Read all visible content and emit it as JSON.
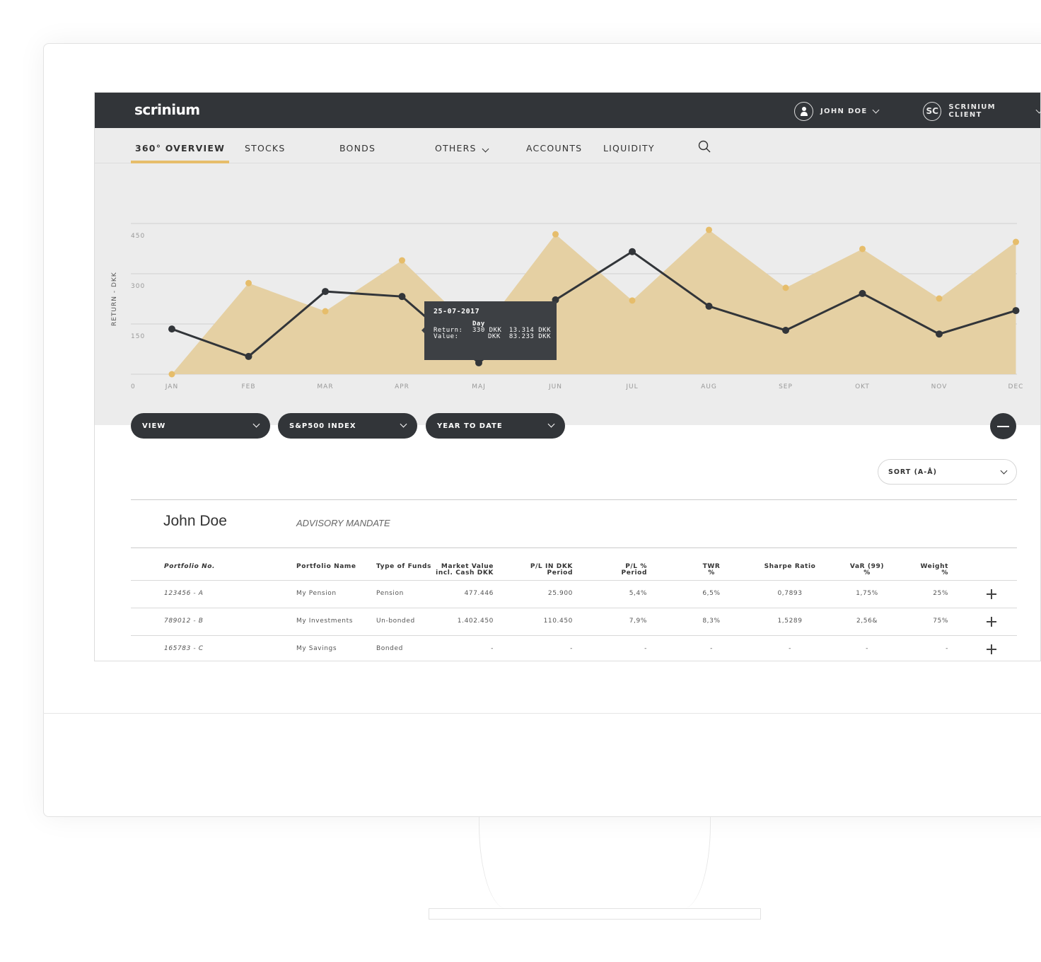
{
  "app": {
    "logo": "scrinium",
    "user": "JOHN DOE",
    "client_initials": "SC",
    "client": "SCRINIUM CLIENT"
  },
  "nav": {
    "tabs": [
      {
        "label": "360° OVERVIEW",
        "active": true
      },
      {
        "label": "STOCKS"
      },
      {
        "label": "BONDS"
      },
      {
        "label": "OTHERS",
        "dropdown": true
      },
      {
        "label": "ACCOUNTS"
      },
      {
        "label": "LIQUIDITY"
      }
    ],
    "search_icon": "search-icon"
  },
  "colors": {
    "accent": "#e6bd6b",
    "area": "#e5d0a3",
    "line": "#323539",
    "dark": "#323539"
  },
  "chart_data": {
    "type": "area+line",
    "ylabel": "RETURN - DKK",
    "ylim": [
      0,
      450
    ],
    "yticks": [
      "0",
      "150",
      "300",
      "450"
    ],
    "categories": [
      "JAN",
      "FEB",
      "MAR",
      "APR",
      "MAJ",
      "JUN",
      "JUL",
      "AUG",
      "SEP",
      "OKT",
      "NOV",
      "DEC"
    ],
    "grid": true,
    "series": [
      {
        "type": "area",
        "color": "#e6bd6b",
        "values": [
          0,
          272,
          188,
          340,
          118,
          418,
          220,
          431,
          258,
          374,
          226,
          395
        ]
      },
      {
        "type": "line",
        "color": "#323539",
        "values": [
          135,
          53,
          247,
          232,
          34,
          222,
          366,
          203,
          131,
          241,
          120,
          190
        ]
      }
    ],
    "tooltip": {
      "date": "25-07-2017",
      "col_header": "Day",
      "row1_label": "Return:",
      "row1_day": "330 DKK",
      "row1_total": "13.314 DKK",
      "row2_label": "Value:",
      "row2_day": "DKK",
      "row2_total": "83.233 DKK"
    }
  },
  "controls": {
    "view": "VIEW",
    "index": "S&P500 INDEX",
    "period": "YEAR TO DATE",
    "sort": "SORT (A-Å)"
  },
  "client": {
    "name": "John Doe",
    "mandate": "ADVISORY MANDATE"
  },
  "table": {
    "headers": [
      [
        "Portfolio No.",
        ""
      ],
      [
        "Portfolio Name",
        ""
      ],
      [
        "Type of Funds",
        ""
      ],
      [
        "Market Value",
        "incl. Cash DKK"
      ],
      [
        "P/L IN DKK",
        "Period"
      ],
      [
        "P/L %",
        "Period"
      ],
      [
        "TWR",
        "%"
      ],
      [
        "Sharpe Ratio",
        ""
      ],
      [
        "VaR (99)",
        "%"
      ],
      [
        "Weight",
        "%"
      ]
    ],
    "rows": [
      [
        "123456 - A",
        "My Pension",
        "Pension",
        "477.446",
        "25.900",
        "5,4%",
        "6,5%",
        "0,7893",
        "1,75%",
        "25%"
      ],
      [
        "789012 - B",
        "My Investments",
        "Un-bonded",
        "1.402.450",
        "110.450",
        "7,9%",
        "8,3%",
        "1,5289",
        "2,56&",
        "75%"
      ],
      [
        "165783 - C",
        "My Savings",
        "Bonded",
        "-",
        "-",
        "-",
        "-",
        "-",
        "-",
        "-"
      ]
    ]
  }
}
